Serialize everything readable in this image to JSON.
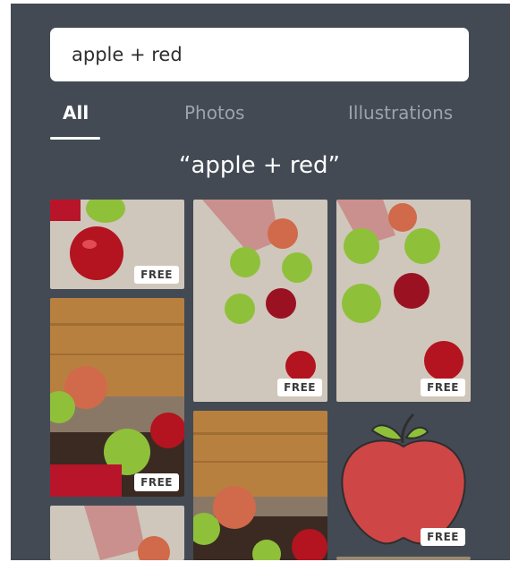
{
  "search": {
    "value": "apple + red"
  },
  "tabs": [
    {
      "label": "All",
      "active": true
    },
    {
      "label": "Photos",
      "active": false
    },
    {
      "label": "Illustrations",
      "active": false
    }
  ],
  "results": {
    "title": "“apple + red”",
    "badge_label": "FREE"
  },
  "colors": {
    "panel": "#434a54",
    "tab_inactive": "#9ba3ad",
    "apple_red": "#b3141f",
    "apple_green": "#8fc03a",
    "tabletop": "#c9c2b6",
    "wood": "#b8803f"
  }
}
